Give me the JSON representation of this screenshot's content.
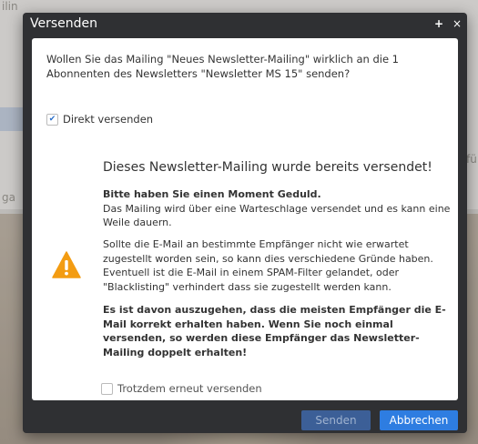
{
  "background": {
    "fragment_top": "ilin",
    "fragment_left": "ga",
    "fragment_right": "fü"
  },
  "dialog": {
    "title": "Versenden",
    "plus_symbol": "+",
    "close_symbol": "×",
    "question": "Wollen Sie das Mailing \"Neues Newsletter-Mailing\" wirklich an die 1 Abonnenten des Newsletters \"Newsletter MS 15\" senden?",
    "direct_send": {
      "label": "Direkt versenden",
      "checked": true
    },
    "warning": {
      "icon": "warning-triangle-icon",
      "color": "#f39c12",
      "heading": "Dieses Newsletter-Mailing wurde bereits versendet!",
      "p1_bold": "Bitte haben Sie einen Moment Geduld.",
      "p1_rest": "Das Mailing wird über eine Warteschlage versendet und es kann eine Weile dauern.",
      "p2": "Sollte die E-Mail an bestimmte Empfänger nicht wie erwartet zugestellt worden sein, so kann dies verschiedene Gründe haben. Eventuell ist die E-Mail in einem SPAM-Filter gelandet, oder \"Blacklisting\" verhindert dass sie zugestellt werden kann.",
      "p3": "Es ist davon auszugehen, dass die meisten Empfänger die E-Mail korrekt erhalten haben. Wenn Sie noch einmal versenden, so werden diese Empfänger das Newsletter-Mailing doppelt erhalten!"
    },
    "resend_anyway": {
      "label": "Trotzdem erneut versenden",
      "checked": false
    },
    "buttons": {
      "send": "Senden",
      "cancel": "Abbrechen"
    },
    "colors": {
      "titlebar": "#2f3033",
      "primary": "#2e7de1",
      "disabled": "#3c5f97"
    }
  }
}
